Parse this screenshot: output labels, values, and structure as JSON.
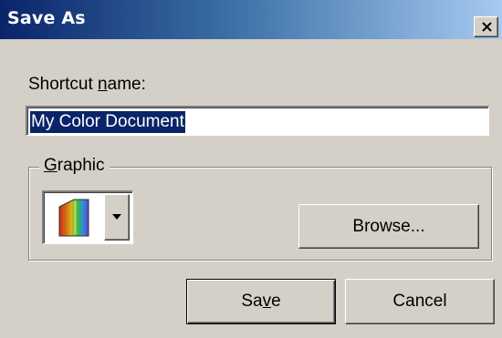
{
  "dialog": {
    "title": "Save As",
    "close_glyph": "×"
  },
  "shortcut": {
    "label_prefix": "Shortcut ",
    "label_accel": "n",
    "label_suffix": "ame:",
    "value": "My Color Document",
    "selected": true
  },
  "graphic": {
    "legend_accel": "G",
    "legend_suffix": "raphic",
    "selected_icon": "color-document-icon",
    "browse_label": "Browse..."
  },
  "buttons": {
    "save_prefix": "Sa",
    "save_accel": "v",
    "save_suffix": "e",
    "cancel": "Cancel"
  },
  "colors": {
    "titlebar_start": "#0a246a",
    "titlebar_end": "#a6caf0",
    "dialog_face": "#d4d0c8",
    "selection": "#0a246a"
  },
  "icons": [
    "close-icon",
    "color-document-icon",
    "dropdown-arrow-icon"
  ]
}
